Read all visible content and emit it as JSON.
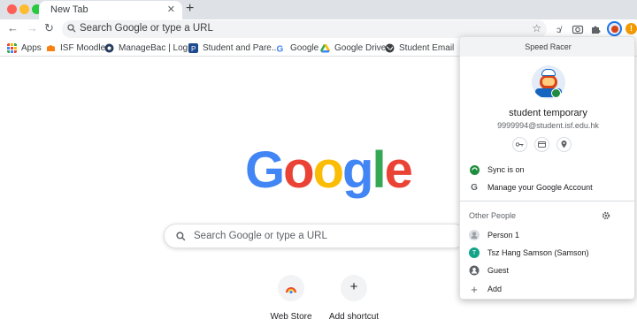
{
  "tab": {
    "title": "New Tab"
  },
  "omnibox": {
    "placeholder": "Search Google or type a URL"
  },
  "bookmarks": [
    {
      "label": "Apps",
      "icon": "apps-grid-icon"
    },
    {
      "label": "ISF Moodle",
      "icon": "moodle-icon"
    },
    {
      "label": "ManageBac | Login",
      "icon": "managebac-icon"
    },
    {
      "label": "Student and Pare...",
      "icon": "student-portal-icon"
    },
    {
      "label": "Google",
      "icon": "google-icon"
    },
    {
      "label": "Google Drive",
      "icon": "drive-icon"
    },
    {
      "label": "Student Email",
      "icon": "globe-icon"
    }
  ],
  "page": {
    "logo": [
      "G",
      "o",
      "o",
      "g",
      "l",
      "e"
    ],
    "search_placeholder": "Search Google or type a URL",
    "shortcuts": [
      {
        "label": "Web Store",
        "icon": "web-store-icon"
      },
      {
        "label": "Add shortcut",
        "icon": "plus-icon"
      }
    ]
  },
  "profile_menu": {
    "header": "Speed Racer",
    "name": "student temporary",
    "email": "9999994@student.isf.edu.hk",
    "quick_actions": [
      "key-icon",
      "card-icon",
      "location-pin-icon"
    ],
    "sync_label": "Sync is on",
    "manage_label": "Manage your Google Account",
    "other_people_label": "Other People",
    "people": [
      {
        "label": "Person 1",
        "avatar": "person-avatar-icon"
      },
      {
        "label": "Tsz Hang Samson (Samson)",
        "avatar_letter": "T"
      },
      {
        "label": "Guest",
        "avatar": "guest-icon"
      }
    ],
    "add_label": "Add"
  },
  "colors": {
    "google_blue": "#4285f4",
    "google_red": "#ea4335",
    "google_yellow": "#fbbc05",
    "google_green": "#34a853",
    "sync_green": "#1e8e3e",
    "samson_teal": "#12a389"
  }
}
